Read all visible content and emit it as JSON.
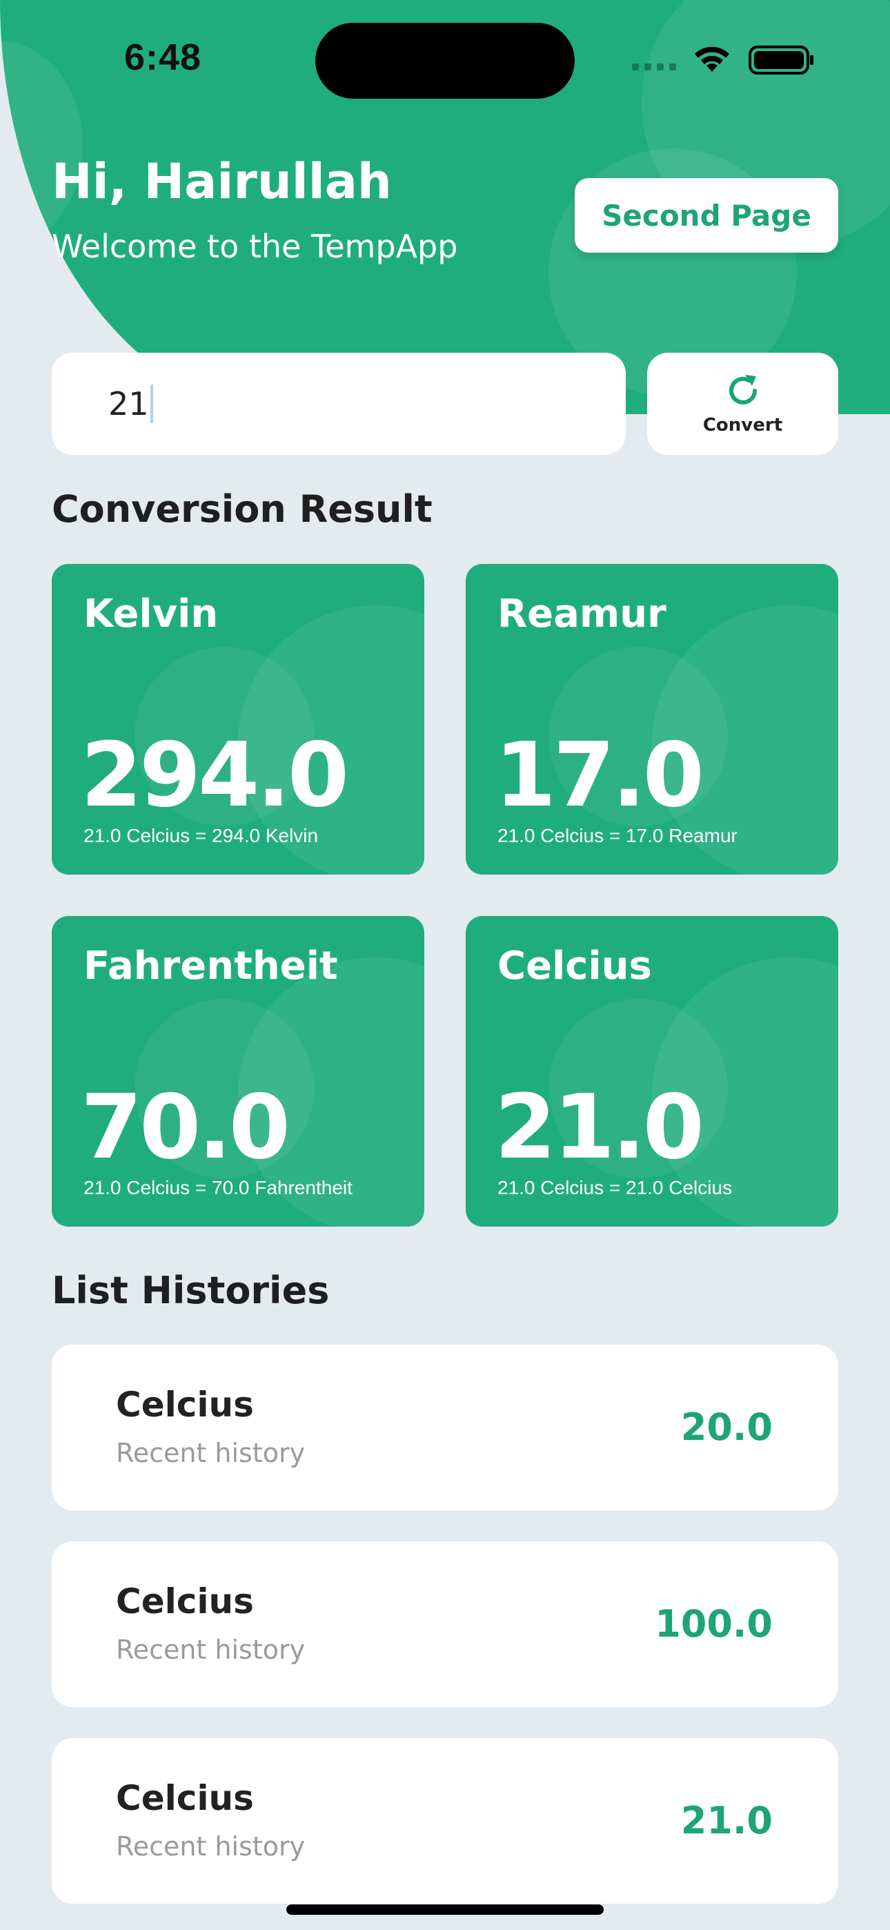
{
  "status_bar": {
    "time": "6:48"
  },
  "header": {
    "greeting": "Hi, Hairullah",
    "subtitle": "Welcome to the TempApp",
    "second_page_label": "Second Page"
  },
  "input": {
    "value": "21"
  },
  "convert": {
    "label": "Convert"
  },
  "conversion_section": {
    "title": "Conversion Result"
  },
  "results": [
    {
      "title": "Kelvin",
      "value": "294.0",
      "desc": "21.0 Celcius = 294.0 Kelvin"
    },
    {
      "title": "Reamur",
      "value": "17.0",
      "desc": "21.0 Celcius = 17.0 Reamur"
    },
    {
      "title": "Fahrentheit",
      "value": "70.0",
      "desc": "21.0 Celcius = 70.0 Fahrentheit"
    },
    {
      "title": "Celcius",
      "value": "21.0",
      "desc": "21.0 Celcius = 21.0 Celcius"
    }
  ],
  "history_section": {
    "title": "List Histories"
  },
  "histories": [
    {
      "name": "Celcius",
      "subtitle": "Recent history",
      "value": "20.0"
    },
    {
      "name": "Celcius",
      "subtitle": "Recent history",
      "value": "100.0"
    },
    {
      "name": "Celcius",
      "subtitle": "Recent history",
      "value": "21.0"
    }
  ],
  "colors": {
    "accent": "#20ad7d",
    "background": "#e4ebee",
    "text_dark": "#1f1f1f",
    "text_muted": "#9a9a9a"
  },
  "icons": {
    "convert": "refresh-icon",
    "signal": "cellular-signal-icon",
    "wifi": "wifi-icon",
    "battery": "battery-icon"
  }
}
